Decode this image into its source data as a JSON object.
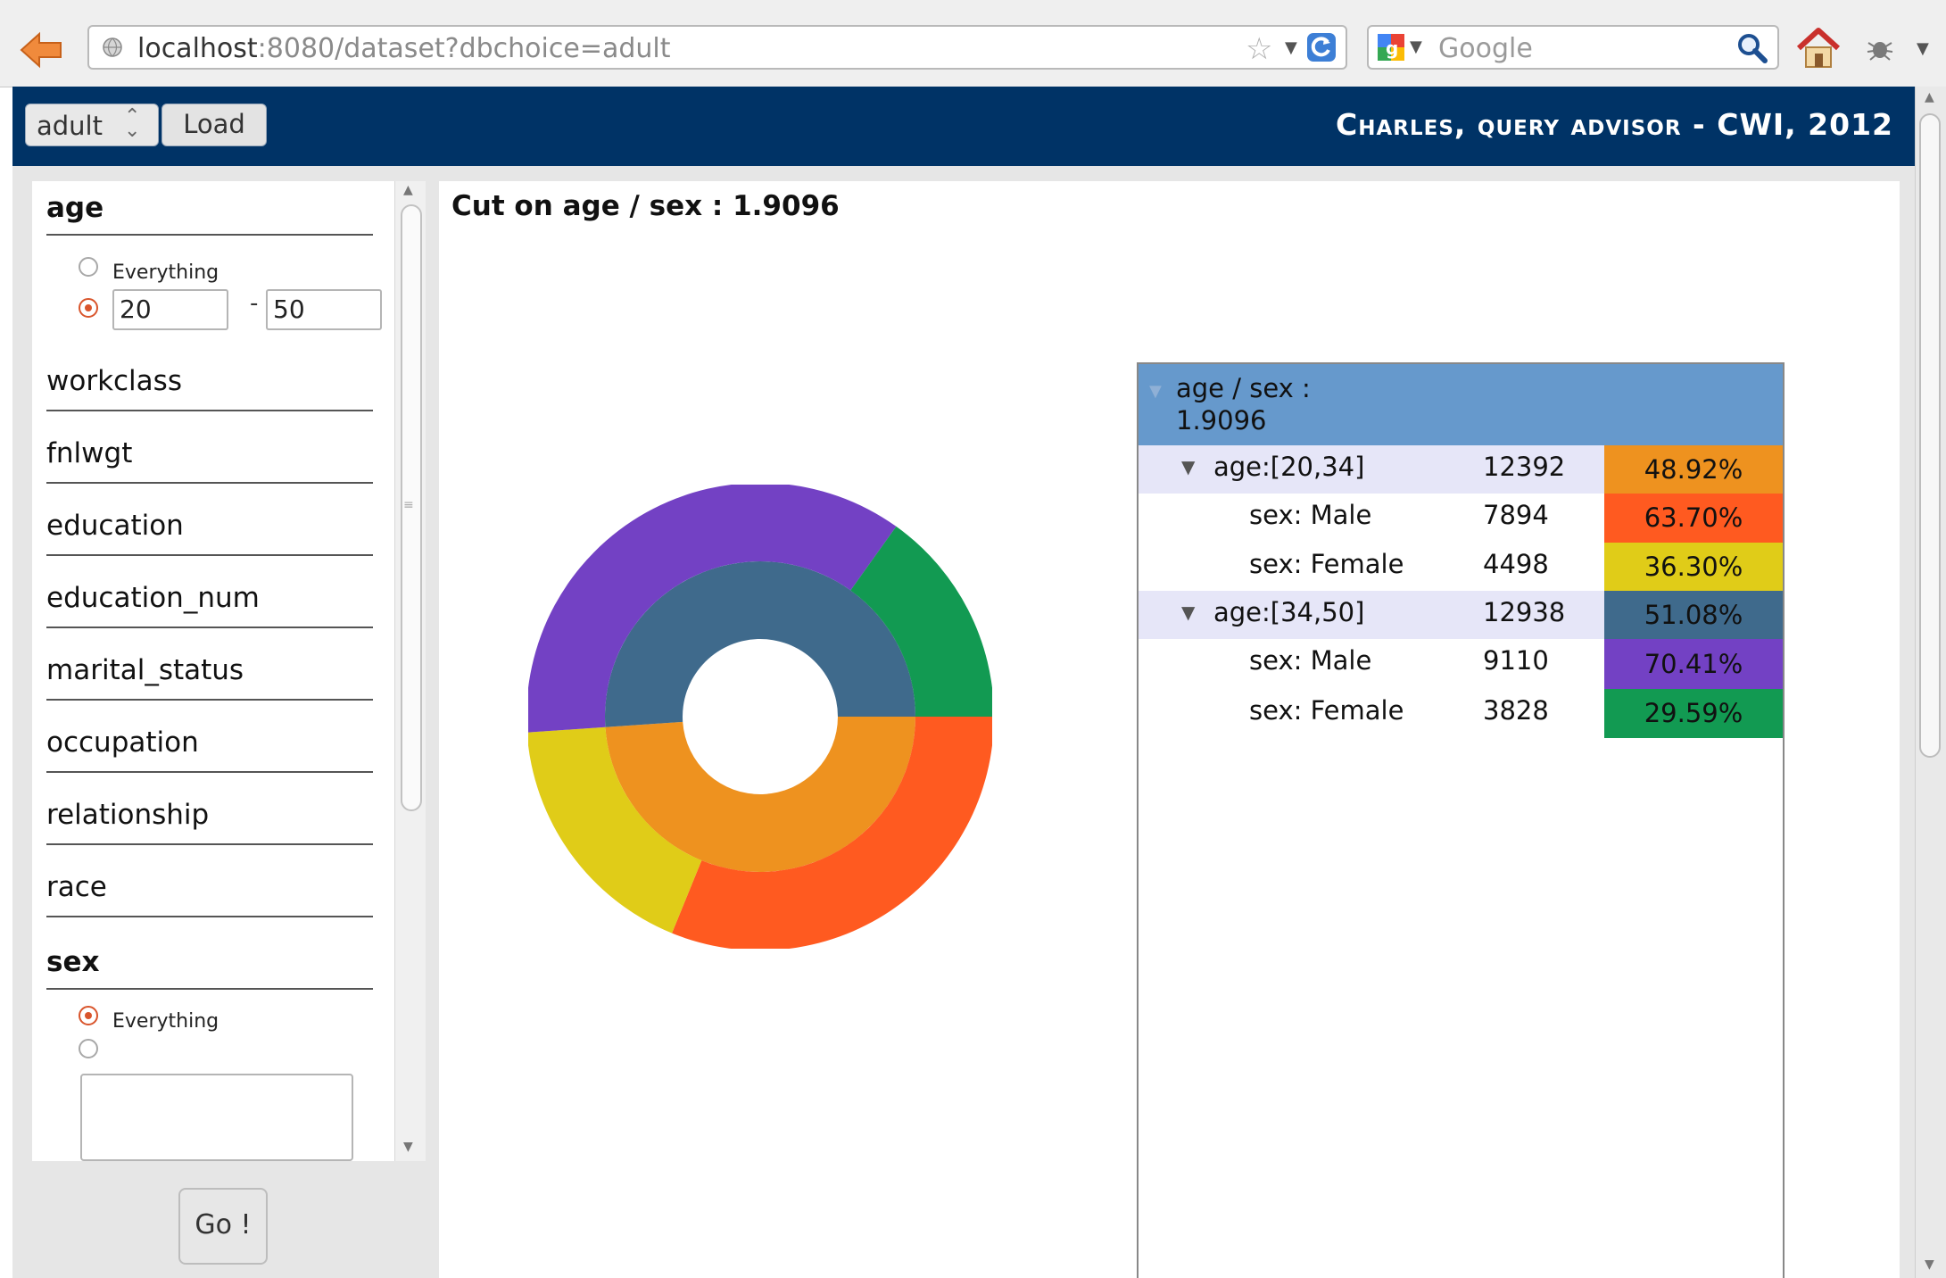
{
  "browser": {
    "url_host": "localhost",
    "url_rest": ":8080/dataset?dbchoice=adult",
    "search_placeholder": "Google"
  },
  "header": {
    "db_choice": "adult",
    "load_label": "Load",
    "title": "Charles, query advisor - CWI, 2012"
  },
  "sidebar": {
    "attributes": [
      {
        "name": "age",
        "selected": true
      },
      {
        "name": "workclass",
        "selected": false
      },
      {
        "name": "fnlwgt",
        "selected": false
      },
      {
        "name": "education",
        "selected": false
      },
      {
        "name": "education_num",
        "selected": false
      },
      {
        "name": "marital_status",
        "selected": false
      },
      {
        "name": "occupation",
        "selected": false
      },
      {
        "name": "relationship",
        "selected": false
      },
      {
        "name": "race",
        "selected": false
      },
      {
        "name": "sex",
        "selected": true
      }
    ],
    "age_filter": {
      "everything_label": "Everything",
      "mode": "range",
      "from": "20",
      "sep": "-",
      "to": "50"
    },
    "sex_filter": {
      "everything_label": "Everything",
      "mode": "everything",
      "value": ""
    },
    "go_label": "Go !"
  },
  "main": {
    "cut_title": "Cut on age / sex : 1.9096",
    "tree": {
      "header_line1": "age / sex :",
      "header_line2": "1.9096",
      "rows": [
        {
          "label": "age:[20,34]",
          "count": "12392",
          "pct": "48.92%",
          "color": "#ee921f",
          "group": true
        },
        {
          "label": "sex: Male",
          "count": "7894",
          "pct": "63.70%",
          "color": "#ff5a20",
          "group": false
        },
        {
          "label": "sex: Female",
          "count": "4498",
          "pct": "36.30%",
          "color": "#e0cc18",
          "group": false
        },
        {
          "label": "age:[34,50]",
          "count": "12938",
          "pct": "51.08%",
          "color": "#3f6a8c",
          "group": true
        },
        {
          "label": "sex: Male",
          "count": "9110",
          "pct": "70.41%",
          "color": "#7341c4",
          "group": false
        },
        {
          "label": "sex: Female",
          "count": "3828",
          "pct": "29.59%",
          "color": "#129a52",
          "group": false
        }
      ]
    }
  },
  "chart_data": {
    "type": "pie",
    "title": "",
    "inner_ring": [
      {
        "label": "age:[20,34]",
        "value": 48.92,
        "color": "#ee921f"
      },
      {
        "label": "age:[34,50]",
        "value": 51.08,
        "color": "#3f6a8c"
      }
    ],
    "outer_ring": [
      {
        "label": "sex: Male",
        "parent": "age:[20,34]",
        "value": 63.7,
        "color": "#ff5a20"
      },
      {
        "label": "sex: Female",
        "parent": "age:[20,34]",
        "value": 36.3,
        "color": "#e0cc18"
      },
      {
        "label": "sex: Male",
        "parent": "age:[34,50]",
        "value": 70.41,
        "color": "#7341c4"
      },
      {
        "label": "sex: Female",
        "parent": "age:[34,50]",
        "value": 29.59,
        "color": "#129a52"
      }
    ]
  }
}
